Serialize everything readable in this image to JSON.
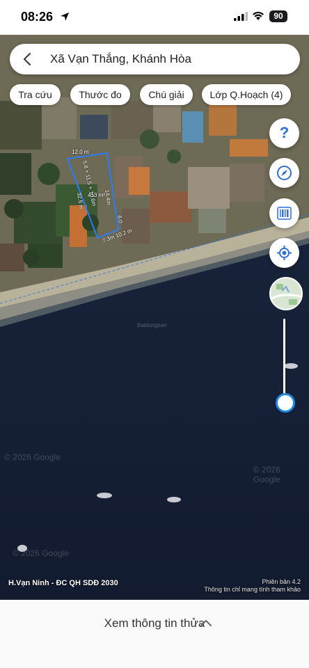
{
  "status": {
    "time": "08:26",
    "battery": "90",
    "icons": [
      "location-arrow-icon",
      "signal-icon",
      "wifi-icon",
      "battery-icon"
    ]
  },
  "search": {
    "text": "Xã Vạn Thắng, Khánh Hòa",
    "icon": "back-icon"
  },
  "chips": [
    {
      "label": "Tra cứu"
    },
    {
      "label": "Thước đo"
    },
    {
      "label": "Chú giải"
    },
    {
      "label": "Lớp Q.Hoạch (4)"
    }
  ],
  "rail": {
    "help_glyph": "?",
    "icons": [
      "help-icon",
      "compass-icon",
      "barcode-icon",
      "locate-icon",
      "map-thumbnail",
      "zoom-slider"
    ],
    "zoom_level": 0.9
  },
  "parcel": {
    "area": "413 m²",
    "edges": [
      "12.0 m",
      "5.8 + 11.5 + 10.6m",
      "14.4m",
      "6.0",
      "7.3m 10.2 m",
      "32.5 m"
    ],
    "boundary_color": "#2d7cf6"
  },
  "map": {
    "watermarks": [
      "© 2026 Google",
      "© 2026 Google",
      "© 2026 Google"
    ],
    "brand_mark": "Batdongsan",
    "layer_name": "H.Vạn Ninh - ĐC QH SDĐ 2030",
    "version": "Phiên bản 4.2",
    "disclaimer": "Thông tin chỉ mang tính tham khảo"
  },
  "bottom": {
    "label": "Xem thông tin thửa",
    "icon": "chevron-up-icon"
  },
  "colors": {
    "accent": "#1e88e5",
    "sea": "#141f36",
    "boundary": "#2d7cf6"
  }
}
